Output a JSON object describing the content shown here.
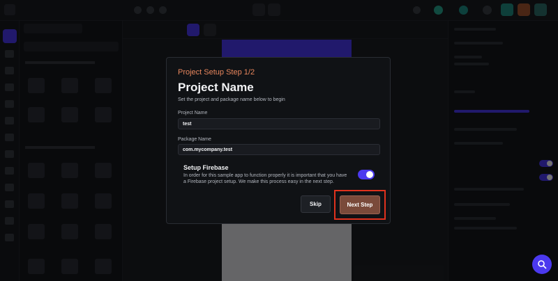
{
  "modal": {
    "step_label": "Project Setup Step 1/2",
    "title": "Project Name",
    "description": "Set the project and package name below to begin",
    "project_name": {
      "label": "Project Name",
      "value": "test"
    },
    "package_name": {
      "label": "Package Name",
      "value": "com.mycompany.test"
    },
    "firebase": {
      "title": "Setup Firebase",
      "description": "In order for this sample app to function properly it is important that you have a Firebase project setup. We make this process easy in the next step.",
      "enabled": true
    },
    "skip_label": "Skip",
    "next_label": "Next Step"
  },
  "colors": {
    "accent": "#4b39ef",
    "step_orange": "#e8865d",
    "next_button": "#7a4a3a",
    "highlight_red": "#e0321e"
  },
  "icons": {
    "fab": "search-icon"
  }
}
